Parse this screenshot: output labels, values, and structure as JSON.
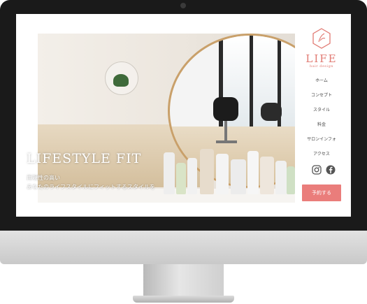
{
  "brand": {
    "name": "LIFE",
    "tagline": "hair design"
  },
  "hero": {
    "title": "LIFESTYLE FIT",
    "subtitle_line1": "再現性の高い",
    "subtitle_line2": "あなたのライフスタイルにフィットするスタイルを"
  },
  "nav": {
    "items": [
      "ホーム",
      "コンセプト",
      "スタイル",
      "料金",
      "サロンインフォ",
      "アクセス"
    ]
  },
  "social": {
    "icons": [
      "instagram-icon",
      "facebook-icon"
    ]
  },
  "cta": {
    "label": "予約する"
  },
  "colors": {
    "accent": "#e17a73",
    "button": "#ea7d7b",
    "bezel": "#1a1a1a"
  }
}
